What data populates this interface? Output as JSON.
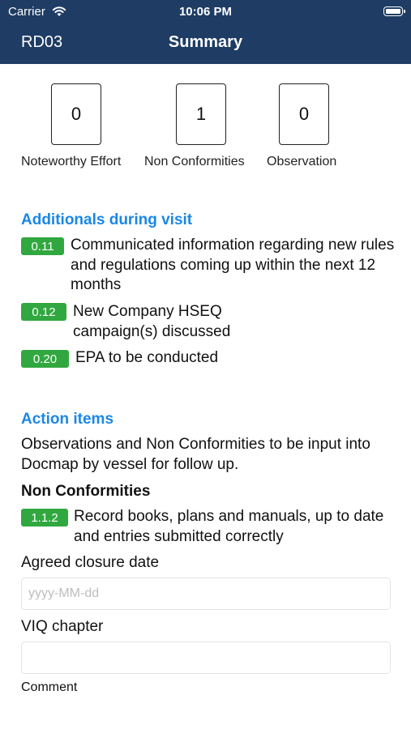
{
  "status_bar": {
    "carrier": "Carrier",
    "time": "10:06 PM"
  },
  "nav": {
    "left_label": "RD03",
    "title": "Summary"
  },
  "counters": [
    {
      "value": "0",
      "label": "Noteworthy Effort"
    },
    {
      "value": "1",
      "label": "Non Conformities"
    },
    {
      "value": "0",
      "label": "Observation"
    }
  ],
  "additionals": {
    "title": "Additionals during visit",
    "items": [
      {
        "badge": "0.11",
        "text": "Communicated information regarding new rules and regulations coming up within the next 12 months"
      },
      {
        "badge": "0.12",
        "text": "New Company HSEQ campaign(s) discussed"
      },
      {
        "badge": "0.20",
        "text": "EPA to be conducted"
      }
    ]
  },
  "action_items": {
    "title": "Action items",
    "description": "Observations and Non Conformities to be input into Docmap by vessel for follow up.",
    "nc_heading": "Non Conformities",
    "nc_items": [
      {
        "badge": "1.1.2",
        "text": "Record books, plans and manuals, up to date and entries submitted correctly"
      }
    ]
  },
  "form": {
    "closure_label": "Agreed closure date",
    "closure_placeholder": "yyyy-MM-dd",
    "viq_label": "VIQ chapter",
    "viq_value": "",
    "comment_label": "Comment"
  },
  "colors": {
    "nav_bg": "#1e3c64",
    "accent": "#1a87e6",
    "badge": "#31a83f"
  }
}
